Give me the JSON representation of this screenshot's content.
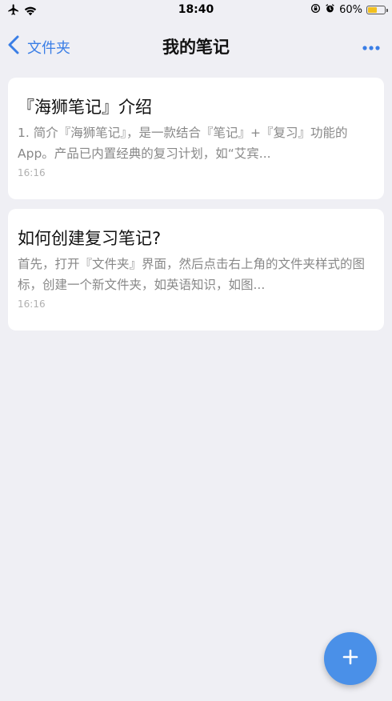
{
  "status_bar": {
    "time": "18:40",
    "battery_percent": "60%",
    "battery_level": 0.6,
    "icons": [
      "airplane-icon",
      "wifi-icon",
      "orientation-lock-icon",
      "alarm-icon",
      "battery-icon"
    ]
  },
  "nav": {
    "back_label": "文件夹",
    "title": "我的笔记",
    "more_icon": "more-icon"
  },
  "notes": [
    {
      "title": "『海狮笔记』介绍",
      "preview": "1. 简介『海狮笔记』，是一款结合『笔记』+『复习』功能的App。产品已内置经典的复习计划，如“艾宾...",
      "time": "16:16"
    },
    {
      "title": "如何创建复习笔记?",
      "preview": "首先，打开『文件夹』界面，然后点击右上角的文件夹样式的图标，创建一个新文件夹，如英语知识，如图...",
      "time": "16:16"
    }
  ],
  "fab": {
    "icon": "plus-icon"
  },
  "colors": {
    "accent": "#3a7ee6",
    "fab": "#4a90e8",
    "background": "#efeff4",
    "card": "#ffffff",
    "battery": "#f2c01e"
  }
}
